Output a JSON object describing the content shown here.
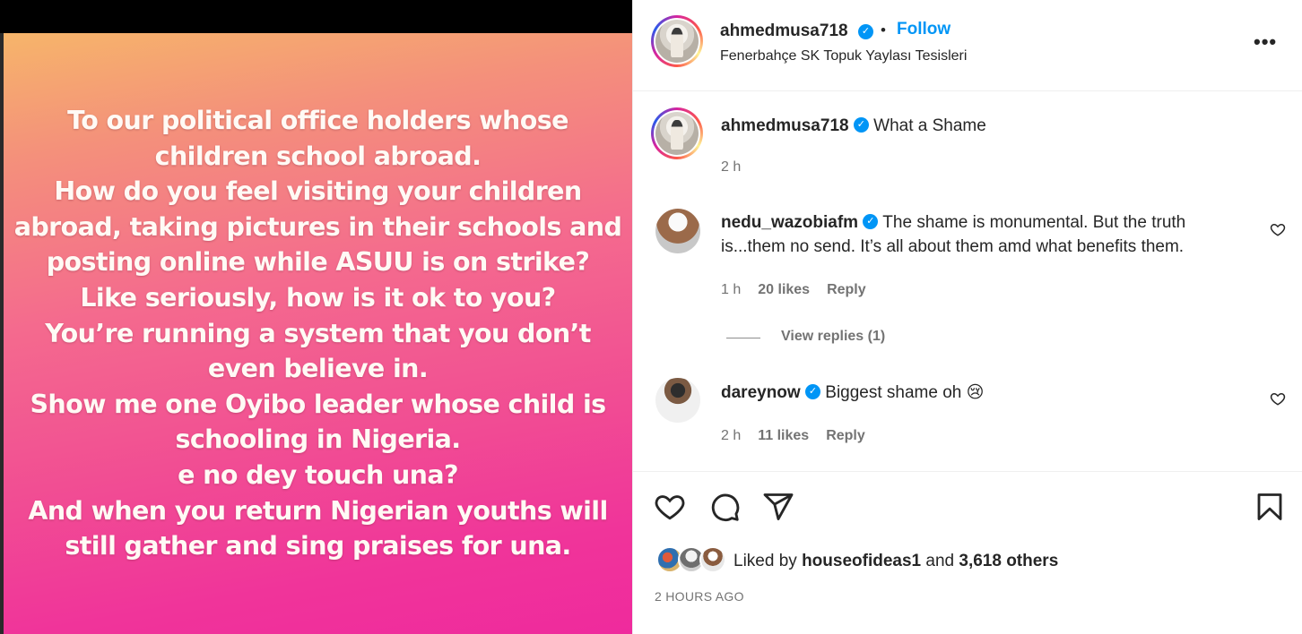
{
  "story": {
    "lines": [
      "To our political office holders whose",
      "children school abroad.",
      "How do you feel visiting your children",
      "abroad, taking pictures in their schools and",
      "posting online while ASUU is on strike?",
      "Like seriously, how is it ok to you?",
      "You’re running a system that you don’t",
      "even believe in.",
      "Show me one Oyibo leader whose child is",
      "schooling in Nigeria.",
      "e no dey touch una?",
      "And when you return Nigerian youths will",
      "still gather and sing praises for una."
    ]
  },
  "header": {
    "username": "ahmedmusa718",
    "dot": "•",
    "follow_label": "Follow",
    "location": "Fenerbahçe SK Topuk Yaylası Tesisleri",
    "more_label": "•••"
  },
  "caption": {
    "username": "ahmedmusa718",
    "text": "What a Shame",
    "time": "2 h"
  },
  "comments": [
    {
      "username": "nedu_wazobiafm",
      "text_line1": "The shame is monumental. But the truth",
      "text_line2": "is...them no send. It’s all about them amd what benefits them.",
      "time": "1 h",
      "likes": "20 likes",
      "reply_label": "Reply",
      "view_replies": "View replies (1)"
    },
    {
      "username": "dareynow",
      "text": "Biggest shame oh 😢",
      "time": "2 h",
      "likes": "11 likes",
      "reply_label": "Reply"
    }
  ],
  "likes": {
    "prefix": "Liked by",
    "user": "houseofideas1",
    "middle": "and",
    "count": "3,618 others"
  },
  "post_time": "2 HOURS AGO",
  "colors": {
    "accent": "#0095f6",
    "secondary_text": "#737373",
    "divider": "#efefef"
  },
  "icons": [
    "verified-badge-icon",
    "more-options-icon",
    "heart-icon",
    "comment-icon",
    "share-icon",
    "bookmark-icon"
  ]
}
